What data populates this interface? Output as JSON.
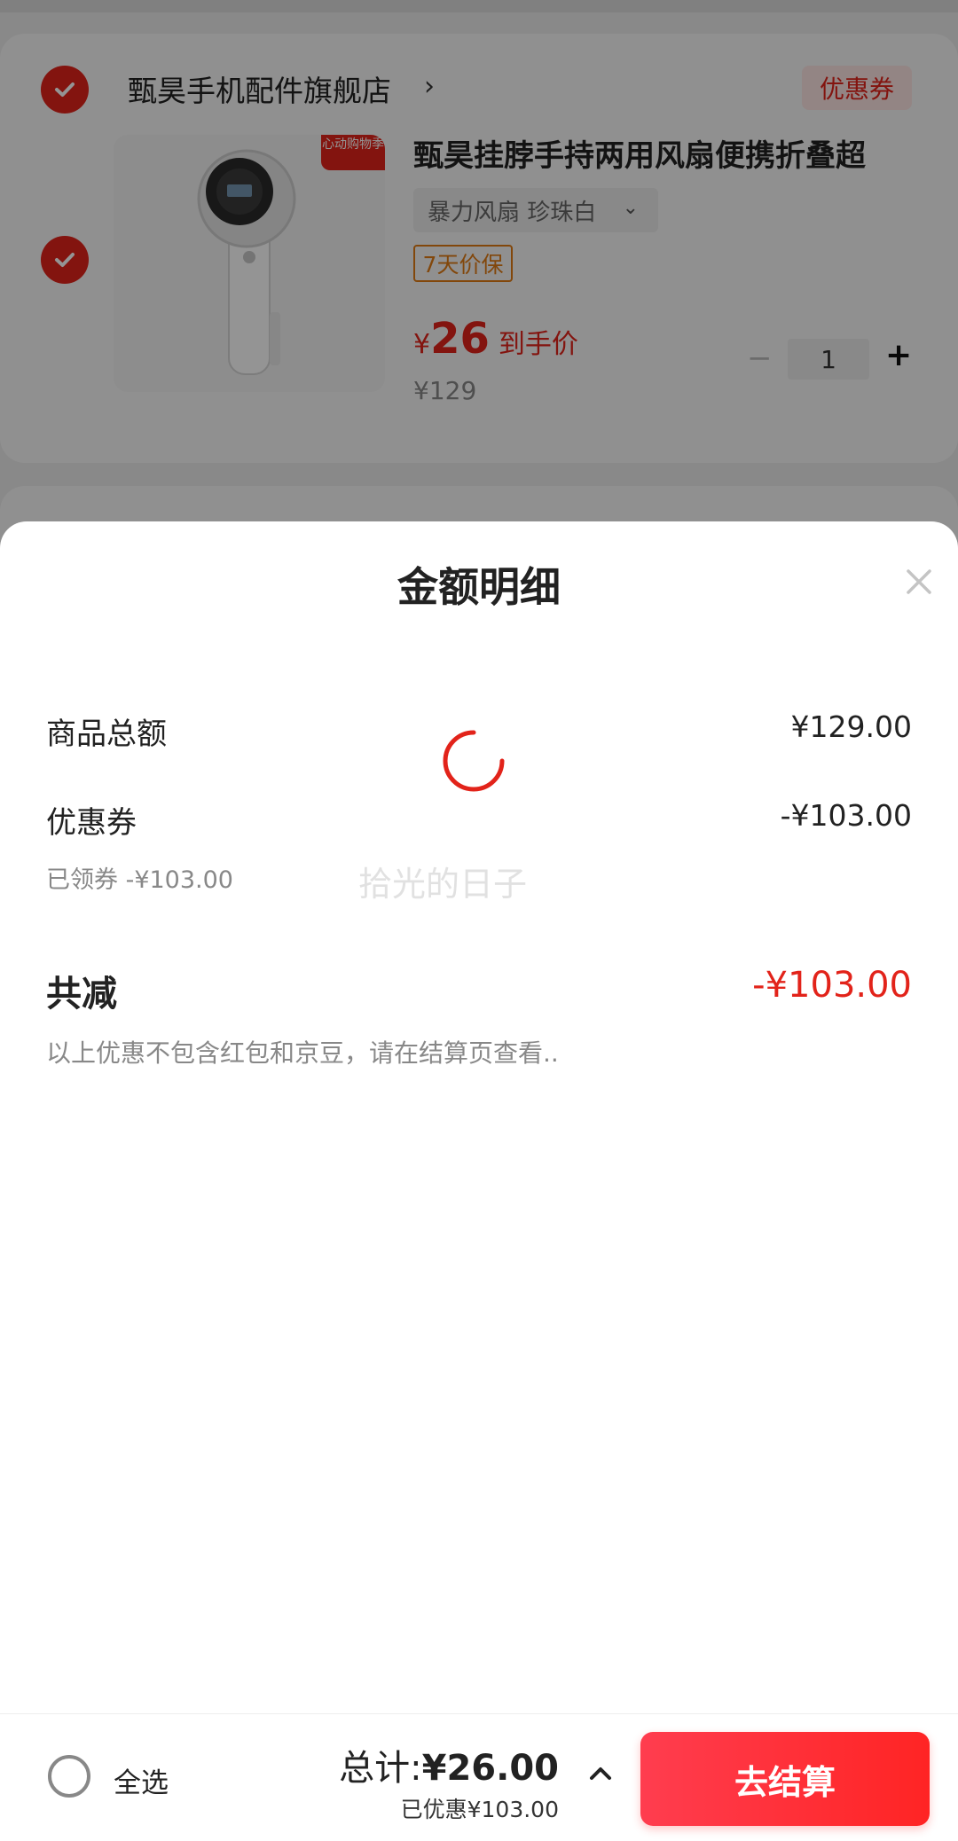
{
  "cart": {
    "store_name": "甄昊手机配件旗舰店",
    "store_arrow": "›",
    "coupon_button": "优惠券",
    "product": {
      "image_tag": "心动购物季",
      "title": "甄昊挂脖手持两用风扇便携折叠超",
      "spec": "暴力风扇 珍珠白",
      "guarantee": "7天价保",
      "price_symbol": "¥",
      "price_now": "26",
      "price_tag": "到手价",
      "price_original": "¥129",
      "quantity": "1",
      "minus": "−",
      "plus": "+"
    }
  },
  "sheet": {
    "title": "金额明细",
    "rows": [
      {
        "label": "商品总额",
        "value": "¥129.00"
      },
      {
        "label": "优惠券",
        "value": "-¥103.00",
        "sub": "已领券 -¥103.00"
      }
    ],
    "total_label": "共减",
    "total_value": "-¥103.00",
    "note": "以上优惠不包含红包和京豆，请在结算页查看..",
    "watermark": "拾光的日子"
  },
  "bottom_bar": {
    "select_all": "全选",
    "total_prefix": "总计:",
    "total_amount": "¥26.00",
    "saved": "已优惠¥103.00",
    "checkout": "去结算"
  },
  "colors": {
    "accent": "#e2231a",
    "checkout_gradient_start": "#ff3d4f",
    "checkout_gradient_end": "#ff2424",
    "guarantee": "#e07b13"
  },
  "icons": [
    "check-icon",
    "close-icon",
    "loading-spinner-icon",
    "chevron-up-icon",
    "chevron-down-icon",
    "chevron-right-icon"
  ]
}
